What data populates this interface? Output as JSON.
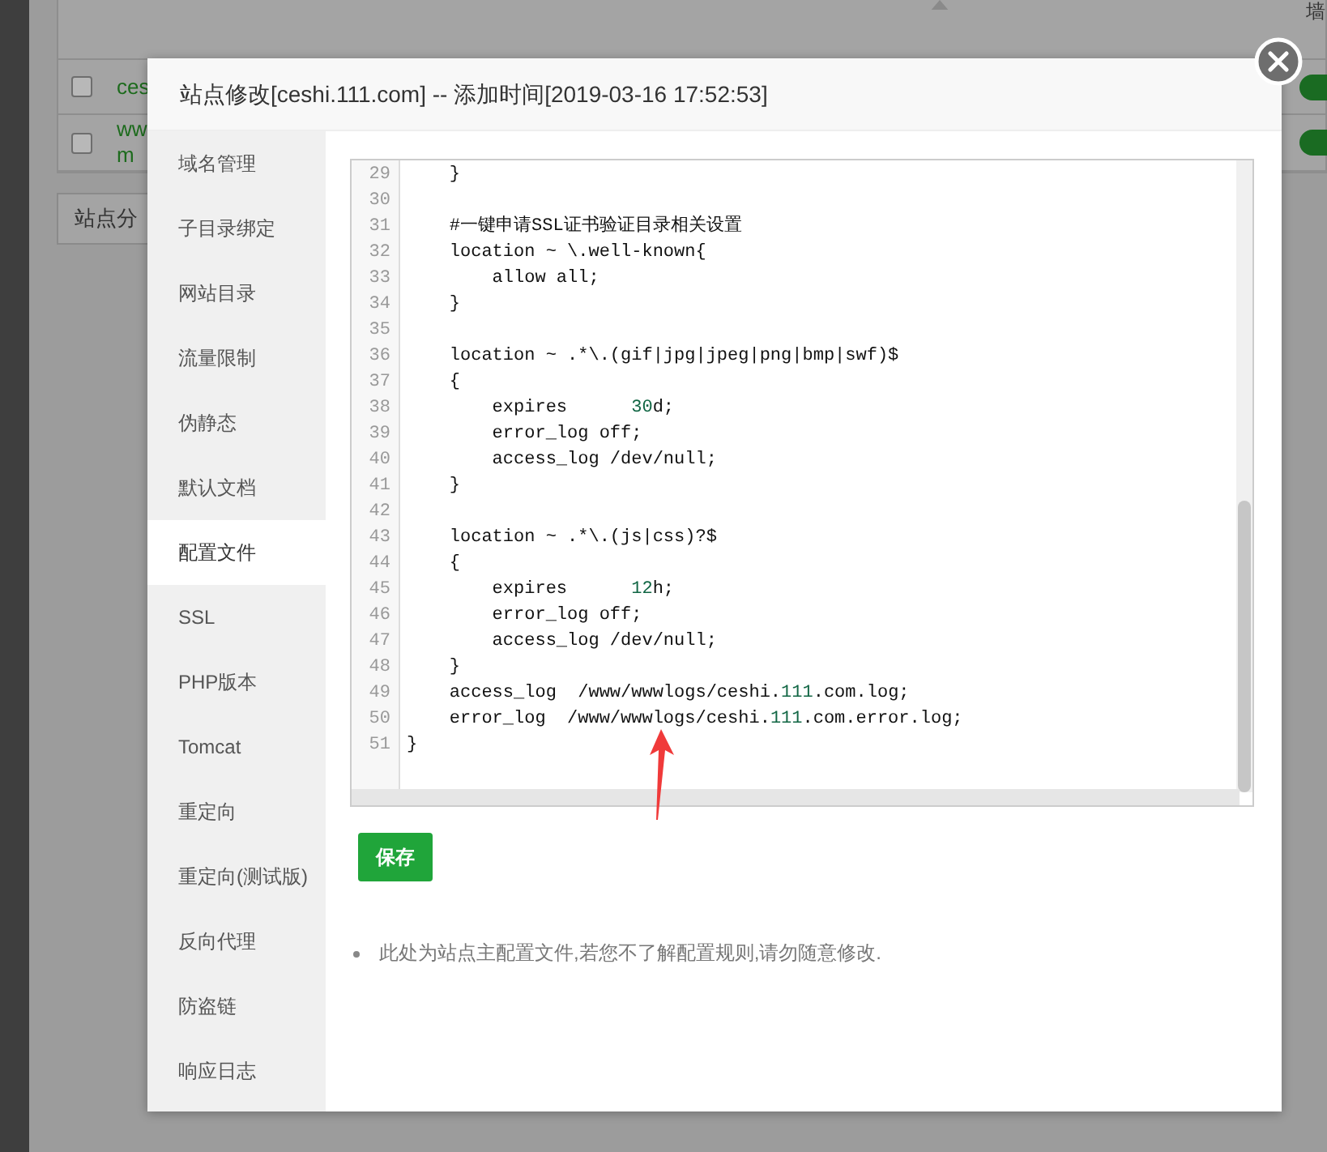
{
  "background_table": {
    "header_cell": "墙",
    "rows": [
      {
        "name_lines": [
          "ces"
        ],
        "checked": false,
        "on": true
      },
      {
        "name_lines": [
          "ww",
          "m"
        ],
        "checked": false,
        "on": true
      }
    ],
    "category_button": "站点分"
  },
  "dialog": {
    "title": "站点修改[ceshi.111.com] -- 添加时间[2019-03-16 17:52:53]",
    "sidebar": {
      "items": [
        {
          "label": "域名管理",
          "selected": false
        },
        {
          "label": "子目录绑定",
          "selected": false
        },
        {
          "label": "网站目录",
          "selected": false
        },
        {
          "label": "流量限制",
          "selected": false
        },
        {
          "label": "伪静态",
          "selected": false
        },
        {
          "label": "默认文档",
          "selected": false
        },
        {
          "label": "配置文件",
          "selected": true
        },
        {
          "label": "SSL",
          "selected": false
        },
        {
          "label": "PHP版本",
          "selected": false
        },
        {
          "label": "Tomcat",
          "selected": false
        },
        {
          "label": "重定向",
          "selected": false
        },
        {
          "label": "重定向(测试版)",
          "selected": false
        },
        {
          "label": "反向代理",
          "selected": false
        },
        {
          "label": "防盗链",
          "selected": false
        },
        {
          "label": "响应日志",
          "selected": false
        }
      ]
    },
    "editor": {
      "lines": [
        {
          "number": "29",
          "tokens": [
            {
              "kind": "plain",
              "text": "    }"
            }
          ]
        },
        {
          "number": "30"
        },
        {
          "number": "31",
          "tokens": [
            {
              "kind": "plain",
              "text": "    #一键申请SSL证书验证目录相关设置"
            }
          ]
        },
        {
          "number": "32",
          "tokens": [
            {
              "kind": "plain",
              "text": "    location ~ \\.well-known{"
            }
          ]
        },
        {
          "number": "33",
          "tokens": [
            {
              "kind": "plain",
              "text": "        allow all;"
            }
          ]
        },
        {
          "number": "34",
          "tokens": [
            {
              "kind": "plain",
              "text": "    }"
            }
          ]
        },
        {
          "number": "35"
        },
        {
          "number": "36",
          "tokens": [
            {
              "kind": "plain",
              "text": "    location ~ .*\\.(gif|jpg|jpeg|png|bmp|swf)$"
            }
          ]
        },
        {
          "number": "37",
          "tokens": [
            {
              "kind": "plain",
              "text": "    {"
            }
          ]
        },
        {
          "number": "38",
          "tokens": [
            {
              "kind": "plain",
              "text": "        expires      "
            },
            {
              "kind": "number",
              "text": "30"
            },
            {
              "kind": "plain",
              "text": "d;"
            }
          ]
        },
        {
          "number": "39",
          "tokens": [
            {
              "kind": "plain",
              "text": "        error_log off;"
            }
          ]
        },
        {
          "number": "40",
          "tokens": [
            {
              "kind": "plain",
              "text": "        access_log /dev/null;"
            }
          ]
        },
        {
          "number": "41",
          "tokens": [
            {
              "kind": "plain",
              "text": "    }"
            }
          ]
        },
        {
          "number": "42"
        },
        {
          "number": "43",
          "tokens": [
            {
              "kind": "plain",
              "text": "    location ~ .*\\.(js|css)?$"
            }
          ]
        },
        {
          "number": "44",
          "tokens": [
            {
              "kind": "plain",
              "text": "    {"
            }
          ]
        },
        {
          "number": "45",
          "tokens": [
            {
              "kind": "plain",
              "text": "        expires      "
            },
            {
              "kind": "number",
              "text": "12"
            },
            {
              "kind": "plain",
              "text": "h;"
            }
          ]
        },
        {
          "number": "46",
          "tokens": [
            {
              "kind": "plain",
              "text": "        error_log off;"
            }
          ]
        },
        {
          "number": "47",
          "tokens": [
            {
              "kind": "plain",
              "text": "        access_log /dev/null;"
            }
          ]
        },
        {
          "number": "48",
          "tokens": [
            {
              "kind": "plain",
              "text": "    }"
            }
          ]
        },
        {
          "number": "49",
          "tokens": [
            {
              "kind": "plain",
              "text": "    access_log  /www/wwwlogs/ceshi."
            },
            {
              "kind": "number",
              "text": "111"
            },
            {
              "kind": "plain",
              "text": ".com.log;"
            }
          ]
        },
        {
          "number": "50",
          "tokens": [
            {
              "kind": "plain",
              "text": "    error_log  /www/wwwlogs/ceshi."
            },
            {
              "kind": "number",
              "text": "111"
            },
            {
              "kind": "plain",
              "text": ".com.error.log;"
            }
          ]
        },
        {
          "number": "51",
          "tokens": [
            {
              "kind": "plain",
              "text": "}"
            }
          ]
        }
      ]
    },
    "save_button": "保存",
    "notes": [
      "此处为站点主配置文件,若您不了解配置规则,请勿随意修改."
    ]
  }
}
